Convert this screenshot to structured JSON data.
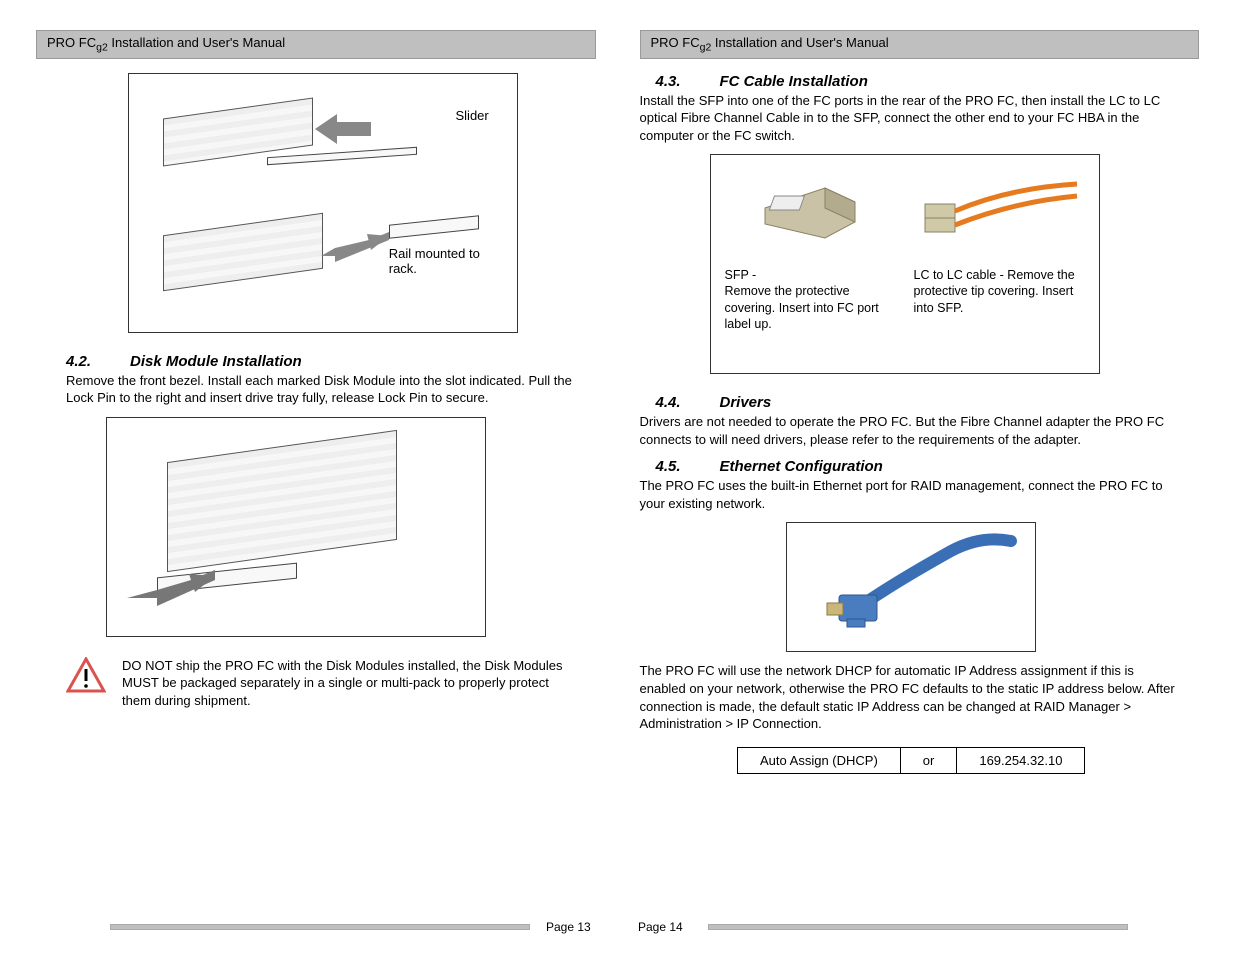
{
  "header": {
    "title_prefix": "PRO FC",
    "title_sub": "g2",
    "title_suffix": " Installation and User's Manual"
  },
  "left": {
    "fig_slider_label": "Slider",
    "fig_rail_label": "Rail mounted to rack.",
    "sec42": {
      "num": "4.2.",
      "title": "Disk Module Installation",
      "body": "Remove the front bezel.  Install each marked Disk Module into the slot indicated.  Pull the Lock Pin to the right and insert drive tray fully, release Lock Pin to secure."
    },
    "warning": "DO NOT ship the PRO FC with the Disk Modules installed, the Disk Modules MUST be packaged separately in a single or multi-pack to properly protect them during shipment.",
    "page_num": "Page 13"
  },
  "right": {
    "sec43": {
      "num": "4.3.",
      "title": "FC Cable Installation",
      "body": "Install the SFP into one of the FC ports in the rear of the PRO FC, then install the LC to LC optical Fibre Channel Cable in to the SFP, connect the other end to your FC HBA in the computer or the FC switch."
    },
    "fc_sfp_caption": "SFP -\nRemove the protective covering.  Insert into FC port label up.",
    "fc_lc_caption": "LC to LC cable - Remove the protective tip covering.  Insert into SFP.",
    "sec44": {
      "num": "4.4.",
      "title": "Drivers",
      "body": "Drivers are not needed to operate the PRO FC.  But the Fibre Channel adapter the PRO FC connects to will need drivers, please refer to the requirements of the adapter."
    },
    "sec45": {
      "num": "4.5.",
      "title": "Ethernet Configuration",
      "body1": "The PRO FC uses the built-in Ethernet port for RAID management, connect the PRO FC to your existing network.",
      "body2": "The PRO FC will use the network DHCP for automatic IP Address assignment if this is enabled on your network, otherwise the PRO FC defaults to the static IP address below.  After connection is made, the default static IP Address can be changed at RAID Manager > Administration > IP Connection."
    },
    "ip_table": {
      "dhcp": "Auto Assign (DHCP)",
      "or": "or",
      "static": "169.254.32.10"
    },
    "page_num": "Page 14"
  }
}
